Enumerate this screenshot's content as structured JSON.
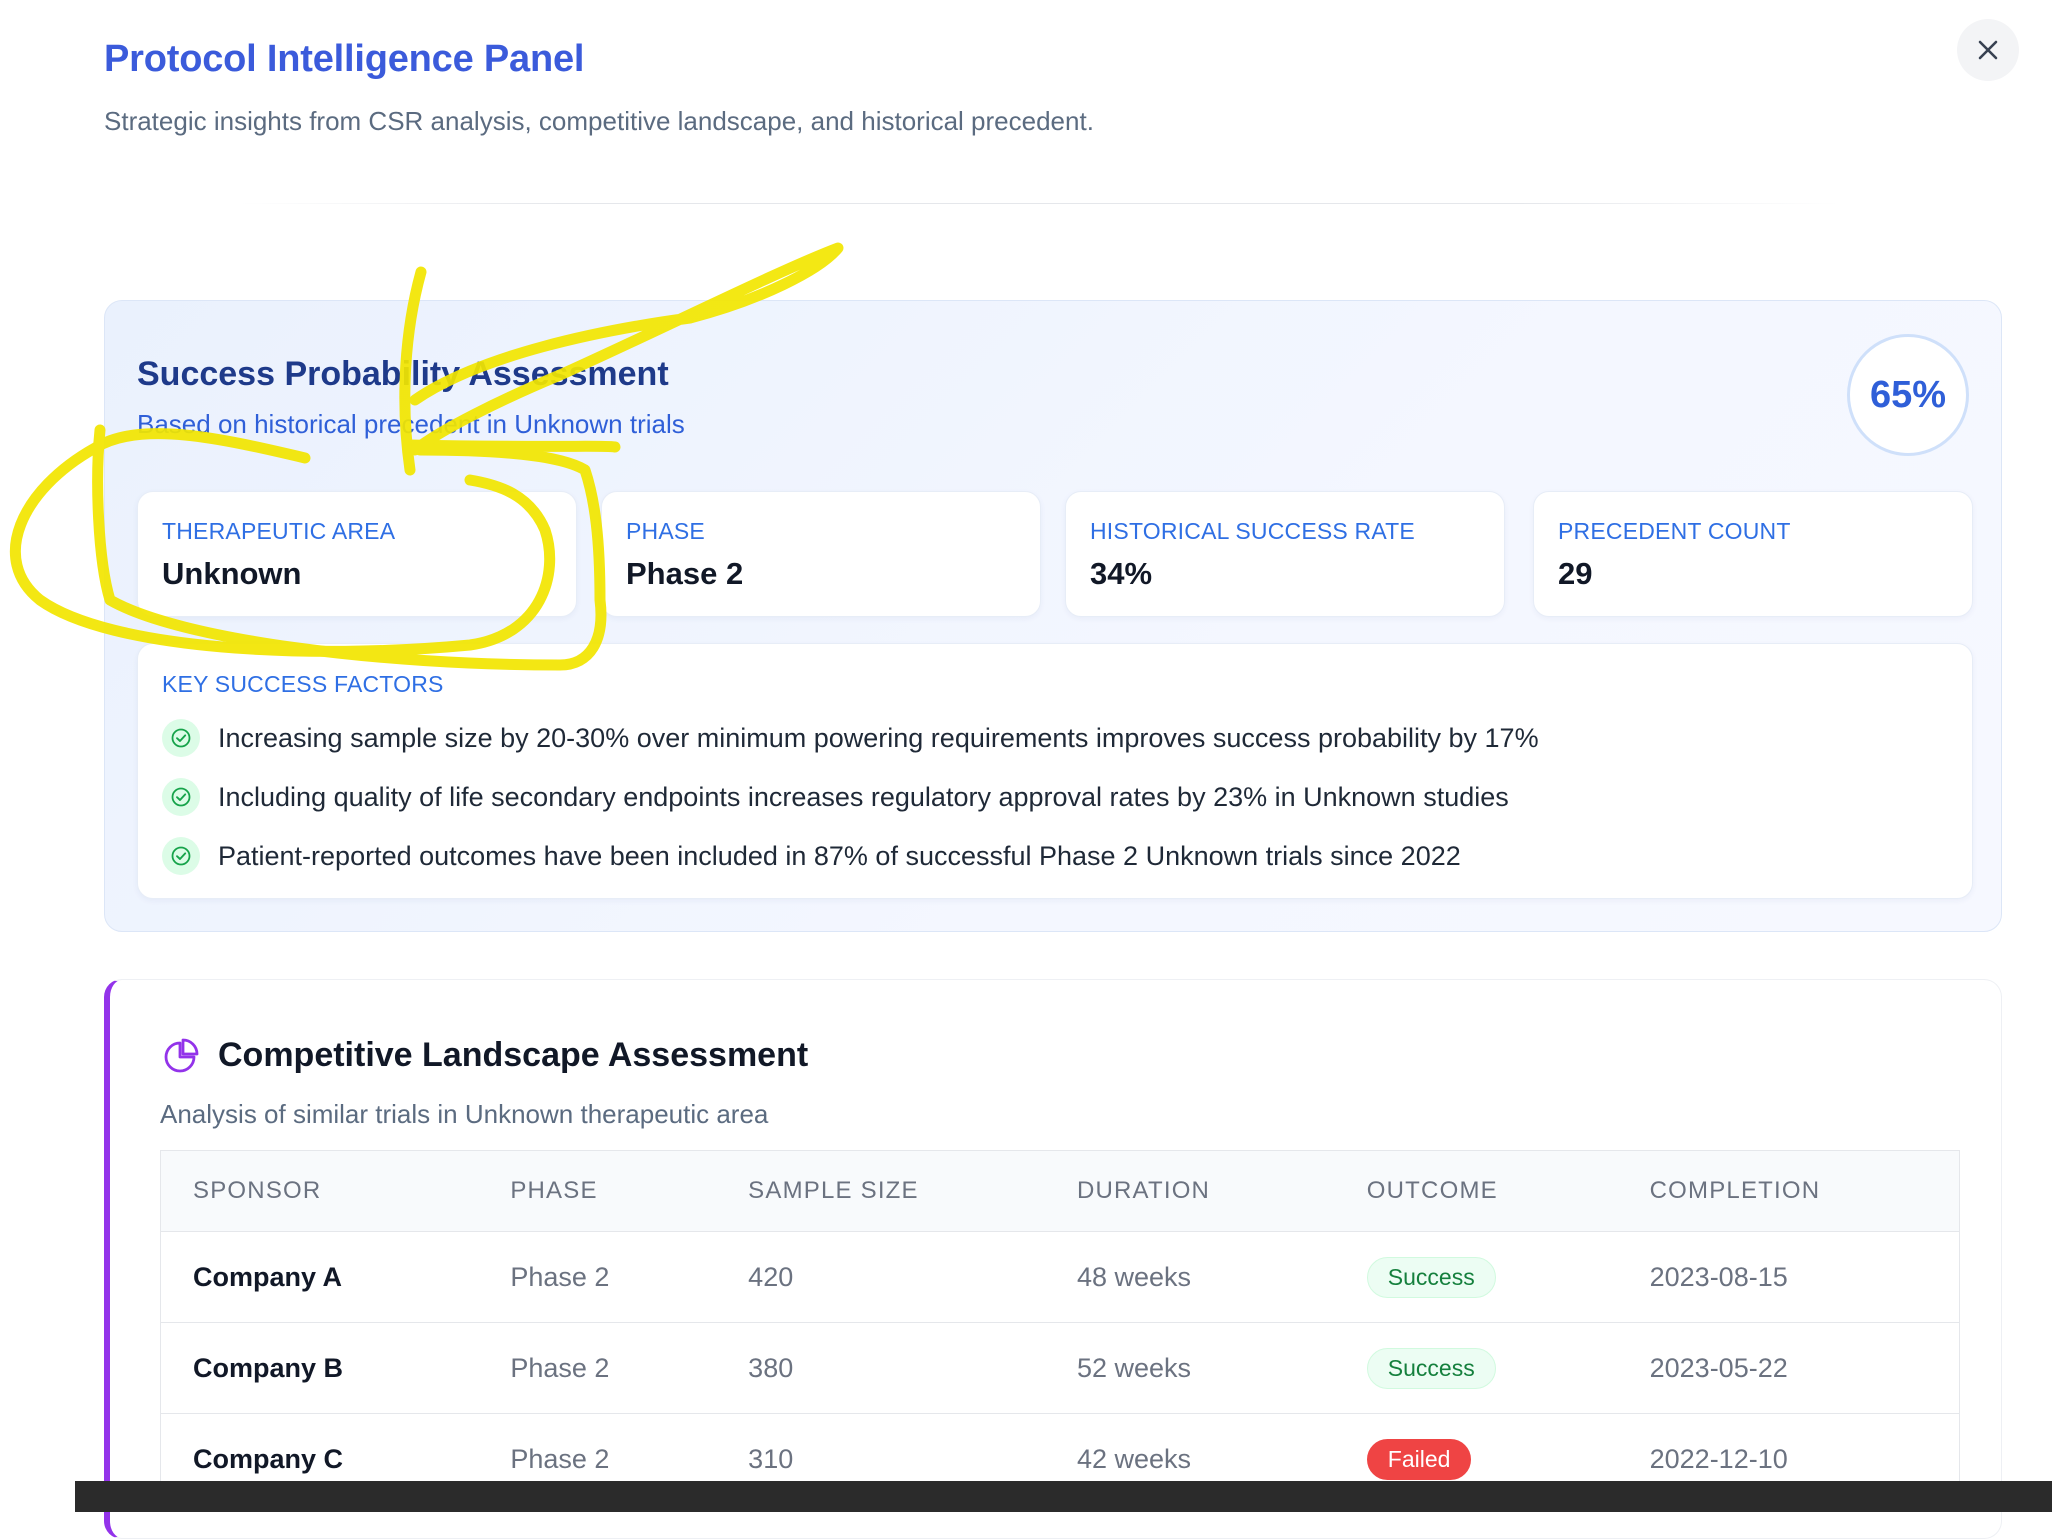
{
  "header": {
    "title": "Protocol Intelligence Panel",
    "subtitle": "Strategic insights from CSR analysis, competitive landscape, and historical precedent."
  },
  "close_icon": "close-icon",
  "success": {
    "title": "Success Probability Assessment",
    "subtitle": "Based on historical precedent in Unknown trials",
    "score": "65%",
    "stats": [
      {
        "label": "THERAPEUTIC AREA",
        "value": "Unknown"
      },
      {
        "label": "PHASE",
        "value": "Phase 2"
      },
      {
        "label": "HISTORICAL SUCCESS RATE",
        "value": "34%"
      },
      {
        "label": "PRECEDENT COUNT",
        "value": "29"
      }
    ],
    "factors_label": "KEY SUCCESS FACTORS",
    "factors": [
      "Increasing sample size by 20-30% over minimum powering requirements improves success probability by 17%",
      "Including quality of life secondary endpoints increases regulatory approval rates by 23% in Unknown studies",
      "Patient-reported outcomes have been included in 87% of successful Phase 2 Unknown trials since 2022"
    ]
  },
  "competitive": {
    "icon": "pie-chart-icon",
    "title": "Competitive Landscape Assessment",
    "subtitle": "Analysis of similar trials in Unknown therapeutic area",
    "columns": [
      "SPONSOR",
      "PHASE",
      "SAMPLE SIZE",
      "DURATION",
      "OUTCOME",
      "COMPLETION"
    ],
    "rows": [
      {
        "sponsor": "Company A",
        "phase": "Phase 2",
        "sample_size": "420",
        "duration": "48 weeks",
        "outcome": "Success",
        "completion": "2023-08-15"
      },
      {
        "sponsor": "Company B",
        "phase": "Phase 2",
        "sample_size": "380",
        "duration": "52 weeks",
        "outcome": "Success",
        "completion": "2023-05-22"
      },
      {
        "sponsor": "Company C",
        "phase": "Phase 2",
        "sample_size": "310",
        "duration": "42 weeks",
        "outcome": "Failed",
        "completion": "2022-12-10"
      }
    ]
  },
  "colors": {
    "accent_blue": "#3b5bdb",
    "success_green": "#15803d",
    "failed_red": "#ef4444",
    "competitive_accent": "#9333ea",
    "highlighter": "#f2e600"
  }
}
